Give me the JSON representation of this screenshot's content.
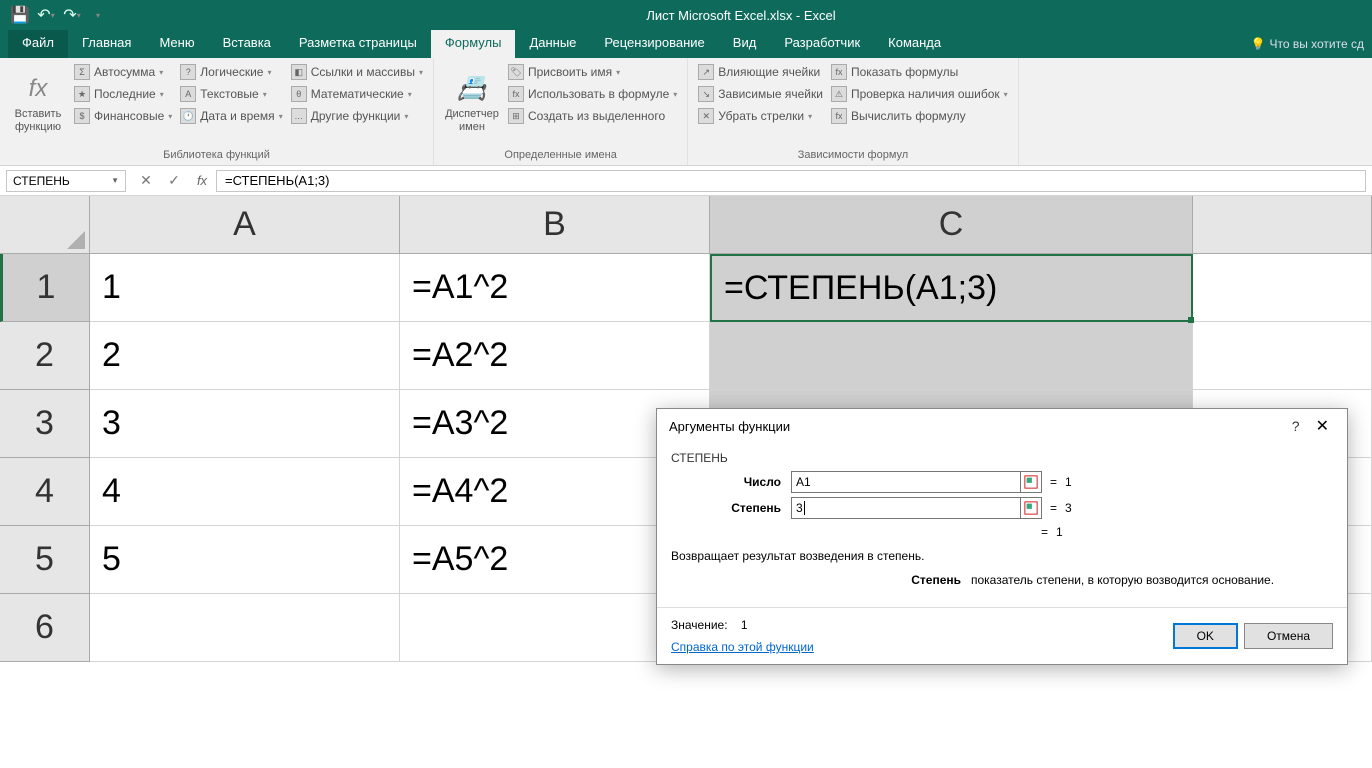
{
  "window_title": "Лист Microsoft Excel.xlsx - Excel",
  "tabs": {
    "file": "Файл",
    "home": "Главная",
    "menu": "Меню",
    "insert": "Вставка",
    "page_layout": "Разметка страницы",
    "formulas": "Формулы",
    "data": "Данные",
    "review": "Рецензирование",
    "view": "Вид",
    "developer": "Разработчик",
    "team": "Команда"
  },
  "tell_me": "Что вы хотите сд",
  "ribbon": {
    "insert_function": "Вставить функцию",
    "autosum": "Автосумма",
    "recent": "Последние",
    "financial": "Финансовые",
    "logical": "Логические",
    "text": "Текстовые",
    "date_time": "Дата и время",
    "lookup": "Ссылки и массивы",
    "math": "Математические",
    "more": "Другие функции",
    "group_library": "Библиотека функций",
    "name_manager": "Диспетчер имен",
    "define_name": "Присвоить имя",
    "use_in_formula": "Использовать в формуле",
    "create_from_selection": "Создать из выделенного",
    "group_defined": "Определенные имена",
    "trace_precedents": "Влияющие ячейки",
    "trace_dependents": "Зависимые ячейки",
    "remove_arrows": "Убрать стрелки",
    "show_formulas": "Показать формулы",
    "error_checking": "Проверка наличия ошибок",
    "evaluate_formula": "Вычислить формулу",
    "group_auditing": "Зависимости формул"
  },
  "namebox": "СТЕПЕНЬ",
  "formula": "=СТЕПЕНЬ(A1;3)",
  "columns": {
    "A": "A",
    "B": "B",
    "C": "C"
  },
  "rows": [
    "1",
    "2",
    "3",
    "4",
    "5",
    "6"
  ],
  "cells": {
    "A1": "1",
    "A2": "2",
    "A3": "3",
    "A4": "4",
    "A5": "5",
    "B1": "=A1^2",
    "B2": "=A2^2",
    "B3": "=A3^2",
    "B4": "=A4^2",
    "B5": "=A5^2",
    "C1": "=СТЕПЕНЬ(A1;3)"
  },
  "dialog": {
    "title": "Аргументы функции",
    "function_name": "СТЕПЕНЬ",
    "arg1_label": "Число",
    "arg1_value": "A1",
    "arg1_result": "1",
    "arg2_label": "Степень",
    "arg2_value": "3",
    "arg2_result": "3",
    "preview_result": "1",
    "description": "Возвращает результат возведения в степень.",
    "arg_desc_label": "Степень",
    "arg_desc_text": "показатель степени, в которую возводится основание.",
    "value_label": "Значение:",
    "value_result": "1",
    "help_link": "Справка по этой функции",
    "ok": "OK",
    "cancel": "Отмена"
  }
}
